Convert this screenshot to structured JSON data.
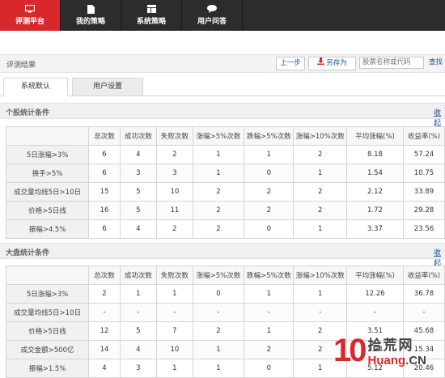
{
  "nav": {
    "items": [
      {
        "label": "评测平台",
        "icon": "monitor-icon",
        "active": true
      },
      {
        "label": "我的策略",
        "icon": "document-icon",
        "active": false
      },
      {
        "label": "系统策略",
        "icon": "layout-icon",
        "active": false
      },
      {
        "label": "用户问答",
        "icon": "chat-bubble-icon",
        "active": false
      }
    ]
  },
  "result": {
    "title": "评测结果",
    "prev_label": "上一步",
    "save_label": "另存为",
    "search_placeholder": "股票名称或代码",
    "query_label": "查找"
  },
  "tabs": [
    {
      "label": "系统默认",
      "active": true
    },
    {
      "label": "用户设置",
      "active": false
    }
  ],
  "stock_section": {
    "title": "个股统计条件",
    "collapse_label": "收起",
    "headers": [
      "",
      "总次数",
      "成功次数",
      "失败次数",
      "涨幅>5%次数",
      "跌幅>5%次数",
      "涨幅>10%次数",
      "平均涨幅(%)",
      "收益率(%)"
    ],
    "rows": [
      [
        "5日涨幅>3%",
        "6",
        "4",
        "2",
        "1",
        "1",
        "2",
        "8.18",
        "57.24"
      ],
      [
        "换手>5%",
        "6",
        "3",
        "3",
        "1",
        "0",
        "1",
        "1.54",
        "10.75"
      ],
      [
        "成交量均线5日>10日",
        "15",
        "5",
        "10",
        "2",
        "2",
        "2",
        "2.12",
        "33.89"
      ],
      [
        "价格>5日线",
        "16",
        "5",
        "11",
        "2",
        "2",
        "2",
        "1.72",
        "29.28"
      ],
      [
        "振幅>4.5%",
        "6",
        "4",
        "2",
        "2",
        "0",
        "1",
        "3.37",
        "23.56"
      ]
    ]
  },
  "market_section": {
    "title": "大盘统计条件",
    "collapse_label": "收起",
    "headers": [
      "",
      "总次数",
      "成功次数",
      "失败次数",
      "涨幅>5%次数",
      "跌幅>5%次数",
      "涨幅>10%次数",
      "平均涨幅(%)",
      "收益率(%)"
    ],
    "rows": [
      [
        "5日涨幅>3%",
        "2",
        "1",
        "1",
        "0",
        "1",
        "1",
        "12.26",
        "36.78"
      ],
      [
        "成交量均线5日>10日",
        "-",
        "-",
        "-",
        "-",
        "-",
        "-",
        "-",
        "-"
      ],
      [
        "价格>5日线",
        "12",
        "5",
        "7",
        "2",
        "1",
        "2",
        "3.51",
        "45.68"
      ],
      [
        "成交金额>500亿",
        "14",
        "4",
        "10",
        "1",
        "2",
        "2",
        "1.24",
        "15.34"
      ],
      [
        "振幅>1.5%",
        "4",
        "3",
        "1",
        "1",
        "0",
        "1",
        "5.12",
        "20.46"
      ]
    ]
  },
  "watermark": {
    "number": "10",
    "chinese": "拾荒网",
    "latin_highlight": "Huang",
    "latin_rest": ".CN"
  },
  "colors": {
    "brand_red": "#d8282b",
    "nav_bg": "#2c2c2c",
    "link_blue": "#1a4f99"
  }
}
